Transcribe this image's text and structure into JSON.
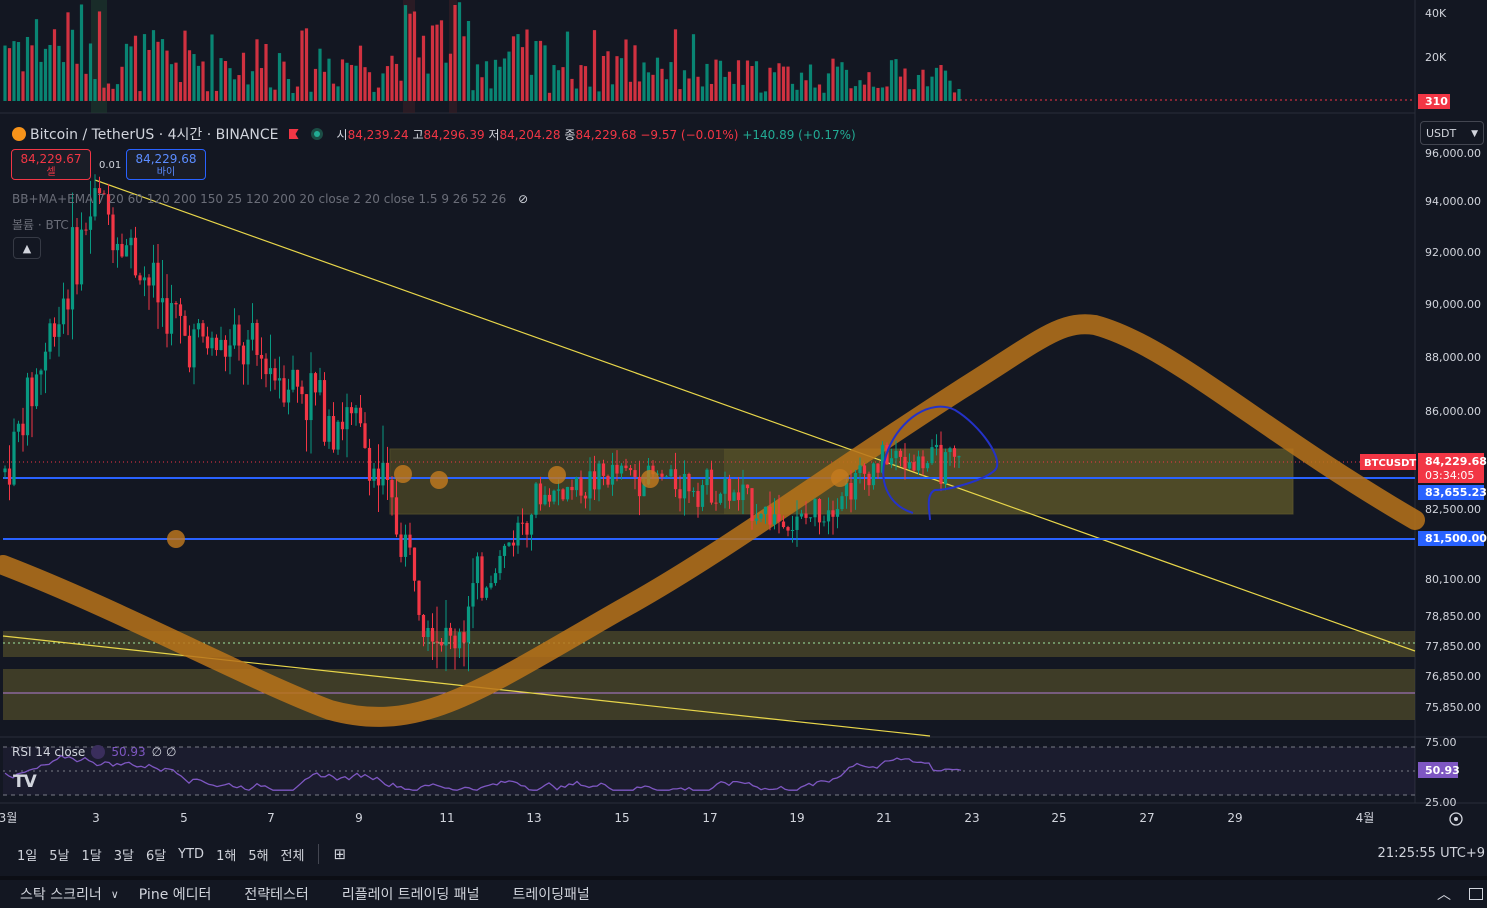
{
  "header": {
    "symbol": "Bitcoin / TetherUS · 4시간 · BINANCE",
    "o_label": "시",
    "o": "84,239.24",
    "h_label": "고",
    "h": "84,296.39",
    "l_label": "저",
    "l": "84,204.28",
    "c_label": "종",
    "c": "84,229.68",
    "change": "−9.57 (−0.01%)",
    "change2": "+140.89 (+0.17%)"
  },
  "trade": {
    "sell_price": "84,229.67",
    "sell_label": "셀",
    "spread": "0.01",
    "buy_price": "84,229.68",
    "buy_label": "바이"
  },
  "indicators": {
    "main": "BB+MA+EMA 7 20 60 120 200 150 25 120 200 20 close 2 20 close 1.5 9 26 52 26",
    "volume": "볼륨 · BTC",
    "rsi_label": "RSI 14 close",
    "rsi_value": "50.93",
    "rsi_extra": "∅ ∅"
  },
  "currency": "USDT",
  "price_axis": [
    "96,000.00",
    "94,000.00",
    "92,000.00",
    "90,000.00",
    "88,000.00",
    "86,000.00",
    "82,500.00",
    "80,100.00",
    "78,850.00",
    "77,850.00",
    "76,850.00",
    "75,850.00"
  ],
  "volume_axis": [
    "40K",
    "20K"
  ],
  "rsi_axis": [
    "75.00",
    "25.00"
  ],
  "tags": {
    "volume": "310",
    "symbol": "BTCUSDT",
    "last_price": "84,229.68",
    "countdown": "03:34:05",
    "level_1": "83,655.23",
    "level_2": "81,500.00",
    "rsi": "50.93"
  },
  "time_axis": [
    "3월",
    "3",
    "5",
    "7",
    "9",
    "11",
    "13",
    "15",
    "17",
    "19",
    "21",
    "23",
    "25",
    "27",
    "29",
    "4월"
  ],
  "timeframes": [
    "1일",
    "5날",
    "1달",
    "3달",
    "6달",
    "YTD",
    "1해",
    "5해",
    "전체"
  ],
  "clock": "21:25:55 UTC+9",
  "bottom_tabs": [
    "스탁 스크리너",
    "Pine 에디터",
    "전략테스터",
    "리플레이 트레이딩 패널",
    "트레이딩패널"
  ],
  "colors": {
    "up": "#089981",
    "down": "#f23645",
    "accent": "#2962ff",
    "band": "#b8731a",
    "rsi": "#7e57c2",
    "zone": "#6b6226"
  },
  "chart_data": {
    "type": "candlestick",
    "interval": "4시간",
    "x_ticks": [
      "3월",
      "3",
      "5",
      "7",
      "9",
      "11",
      "13",
      "15",
      "17",
      "19",
      "21",
      "23",
      "25",
      "27",
      "29",
      "4월"
    ],
    "ylim": [
      75000,
      96000
    ],
    "close_trend": [
      {
        "day": "3월 1",
        "close": 84000
      },
      {
        "day": "3월 3",
        "close": 94200
      },
      {
        "day": "3월 5",
        "close": 89000
      },
      {
        "day": "3월 7",
        "close": 88000
      },
      {
        "day": "3월 9",
        "close": 85500
      },
      {
        "day": "3월 11",
        "close": 77500
      },
      {
        "day": "3월 13",
        "close": 83000
      },
      {
        "day": "3월 15",
        "close": 84000
      },
      {
        "day": "3월 17",
        "close": 83500
      },
      {
        "day": "3월 19",
        "close": 82000
      },
      {
        "day": "3월 21",
        "close": 84500
      },
      {
        "day": "3월 22",
        "close": 84229.68
      }
    ],
    "horizontal_levels": [
      83655.23,
      81500.0
    ],
    "last_price": 84229.68,
    "rsi": {
      "length": 14,
      "value": 50.93,
      "bands": [
        75,
        25
      ]
    }
  }
}
